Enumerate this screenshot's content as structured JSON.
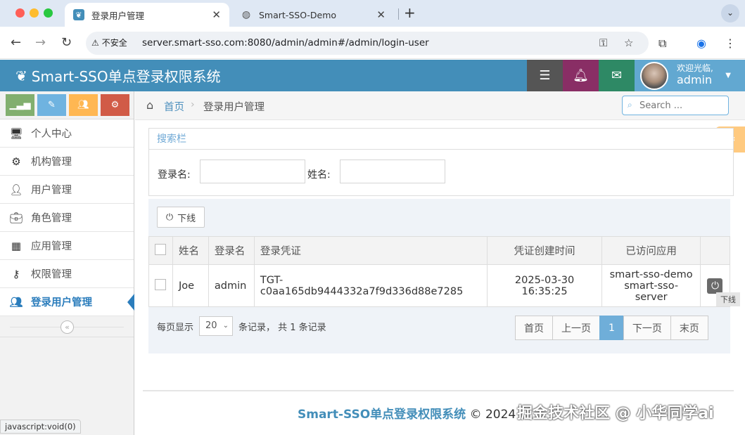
{
  "browser": {
    "tabs": [
      {
        "title": "登录用户管理",
        "active": true
      },
      {
        "title": "Smart-SSO-Demo",
        "active": false
      }
    ],
    "insecure_label": "不安全",
    "url": "server.smart-sso.com:8080/admin/admin#/admin/login-user",
    "status_text": "javascript:void(0)"
  },
  "header": {
    "app_title": "Smart-SSO单点登录权限系统",
    "welcome": "欢迎光临,",
    "username": "admin"
  },
  "sidebar": {
    "items": [
      {
        "label": "个人中心",
        "icon": "desktop-icon"
      },
      {
        "label": "机构管理",
        "icon": "cogs-icon"
      },
      {
        "label": "用户管理",
        "icon": "user-icon"
      },
      {
        "label": "角色管理",
        "icon": "briefcase-icon"
      },
      {
        "label": "应用管理",
        "icon": "th-large-icon"
      },
      {
        "label": "权限管理",
        "icon": "key-icon"
      },
      {
        "label": "登录用户管理",
        "icon": "users-icon",
        "active": true
      }
    ]
  },
  "breadcrumb": {
    "home": "首页",
    "current": "登录用户管理",
    "search_placeholder": "Search ..."
  },
  "search_panel": {
    "title": "搜索栏",
    "login_name_label": "登录名:",
    "name_label": "姓名:"
  },
  "toolbar": {
    "logout_label": "下线"
  },
  "table": {
    "headers": [
      "姓名",
      "登录名",
      "登录凭证",
      "凭证创建时间",
      "已访问应用"
    ],
    "rows": [
      {
        "name": "Joe",
        "login_name": "admin",
        "ticket": "TGT-c0aa165db9444332a7f9d336d88e7285",
        "created": "2025-03-30 16:35:25",
        "apps_line1": "smart-sso-demo",
        "apps_line2": "smart-sso-server"
      }
    ],
    "tooltip": "下线"
  },
  "pagination": {
    "per_page_label": "每页显示",
    "page_size": "20",
    "summary": "条记录， 共 1 条记录",
    "first": "首页",
    "prev": "上一页",
    "current": "1",
    "next": "下一页",
    "last": "末页"
  },
  "footer": {
    "brand": "Smart-SSO单点登录权限系统",
    "copyright": "© 2024",
    "watermark": "掘金技术社区 @ 小华同学ai"
  },
  "colors": {
    "header": "#438eb9",
    "user_area": "#62a8d1",
    "active_nav": "#2b7dbc",
    "pager_active": "#6faed9"
  }
}
